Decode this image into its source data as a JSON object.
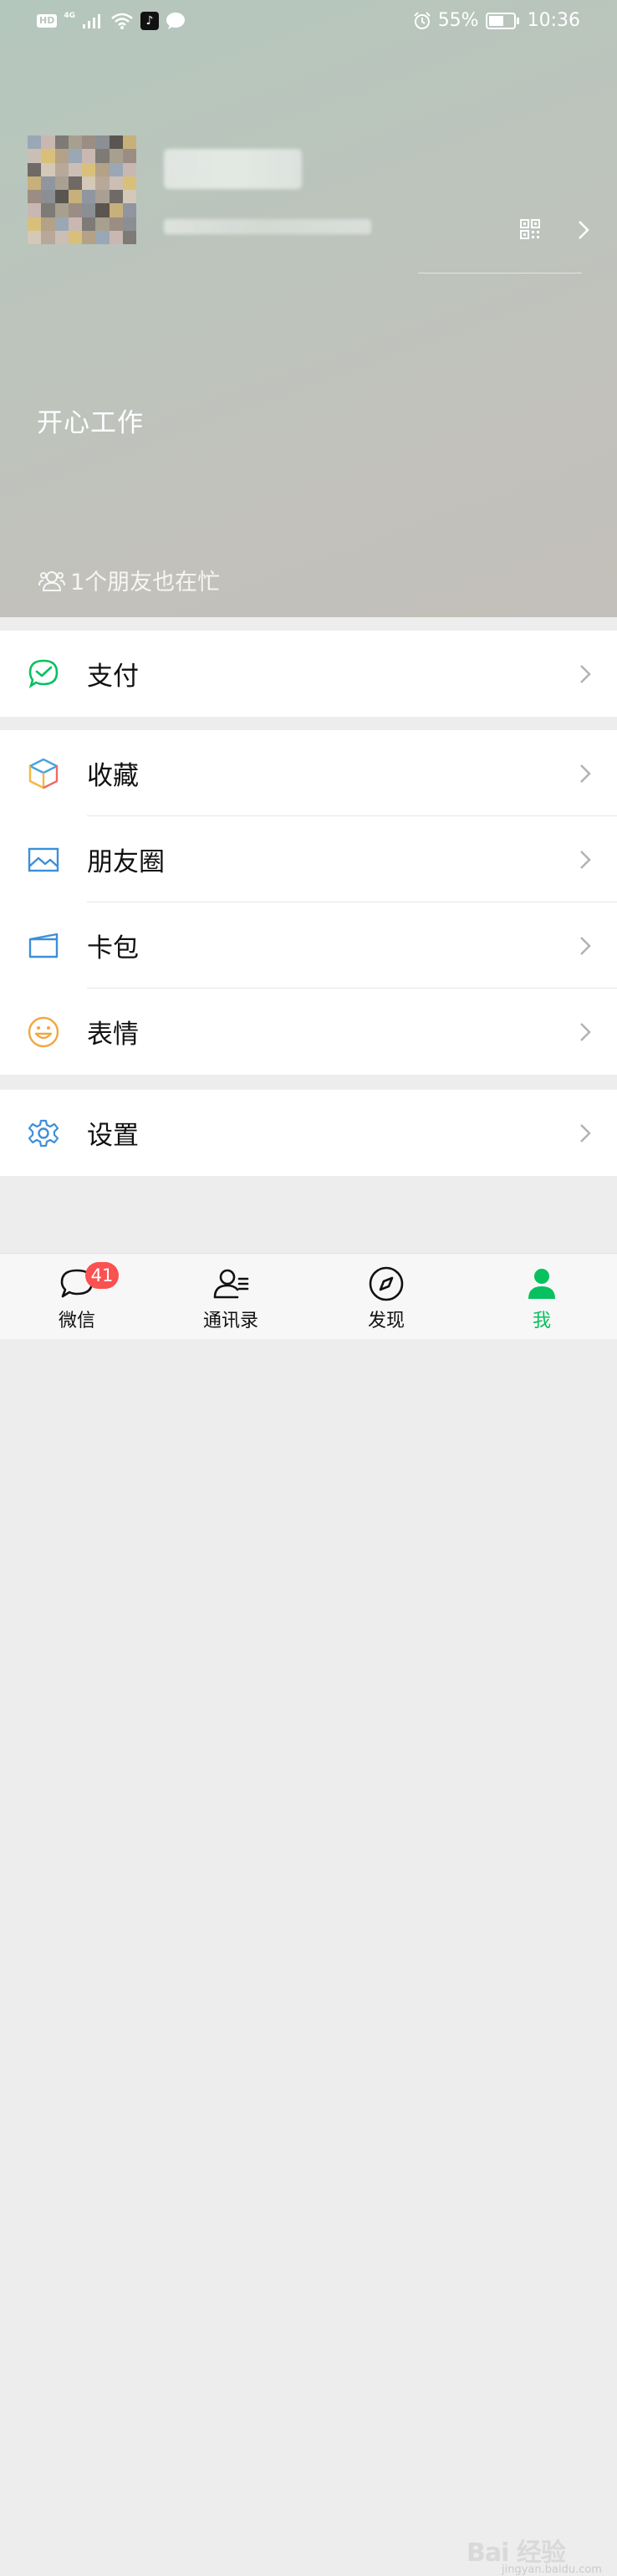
{
  "status_bar": {
    "hd": "HD",
    "network": "4G",
    "battery": "55%",
    "battery_level": 0.55,
    "time": "10:36"
  },
  "profile": {
    "status_text": "开心工作",
    "friends_busy": "1个朋友也在忙"
  },
  "menu": {
    "pay": "支付",
    "favorites": "收藏",
    "moments": "朋友圈",
    "cards": "卡包",
    "stickers": "表情",
    "settings": "设置"
  },
  "tabs": [
    {
      "label": "微信",
      "badge": "41"
    },
    {
      "label": "通讯录"
    },
    {
      "label": "发现"
    },
    {
      "label": "我"
    }
  ],
  "watermark": {
    "main": "Bai 经验",
    "sub": "jingyan.baidu.com"
  },
  "colors": {
    "accent": "#07c160",
    "badge": "#fa5151"
  }
}
